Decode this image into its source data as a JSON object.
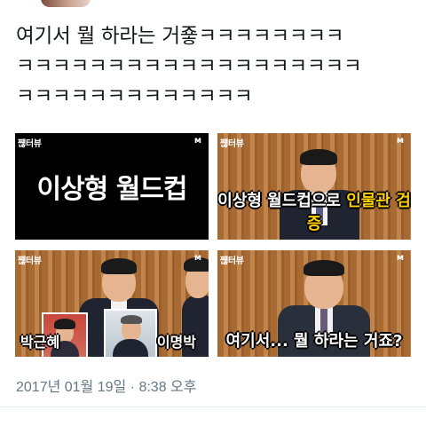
{
  "tweet": {
    "lines": [
      "여기서 뭘 하라는 거죻ㅋㅋㅋㅋㅋㅋㅋㅋ",
      "ㅋㅋㅋㅋㅋㅋㅋㅋㅋㅋㅋㅋㅋㅋㅋㅋㅋㅋㅋ",
      "ㅋㅋㅋㅋㅋㅋㅋㅋㅋㅋㅋㅋㅋ"
    ],
    "timestamp": "2017년 01월 19일 · 8:38 오후"
  },
  "media": {
    "source_badge": "쨶터뷰",
    "logo_icon": "m-logo-icon",
    "tiles": [
      {
        "title": "이상형 월드컵"
      },
      {
        "caption_main": "이상형 월드컵으로 ",
        "caption_highlight": "인물관 검증"
      },
      {
        "label_left": "박근혜",
        "label_right": "이명박"
      },
      {
        "caption_main": "여기서... 뭘 하라는 거죠?"
      }
    ]
  },
  "colors": {
    "text": "#14171a",
    "timestamp": "#657786",
    "highlight": "#ffd000",
    "wood": "#b37a3f"
  }
}
